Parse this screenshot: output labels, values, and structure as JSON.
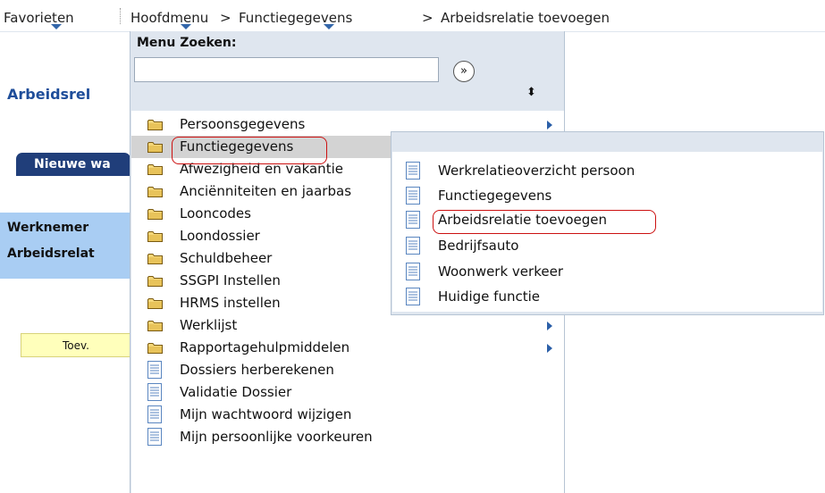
{
  "nav": {
    "favorieten": "Favorieten",
    "hoofdmenu": "Hoofdmenu",
    "sep1": ">",
    "functiegegevens": "Functiegegevens",
    "sep2": ">",
    "arbeidsrelatie": "Arbeidsrelatie toevoegen"
  },
  "background_page": {
    "title": "Arbeidsrel",
    "new_button": "Nieuwe wa",
    "info_line1": "Werknemer",
    "info_line2": "Arbeidsrelat",
    "toev_button": "Toev."
  },
  "menu_search": {
    "label": "Menu Zoeken:",
    "value": "",
    "go_symbol": "»",
    "sort_symbol": "⬍"
  },
  "menu_items": [
    {
      "label": "Persoonsgegevens",
      "icon": "folder-icon",
      "has_submenu": true
    },
    {
      "label": "Functiegegevens",
      "icon": "folder-icon",
      "has_submenu": false,
      "selected": true
    },
    {
      "label": "Afwezigheid en vakantie",
      "icon": "folder-icon",
      "has_submenu": false
    },
    {
      "label": "Anciënniteiten en jaarbas",
      "icon": "folder-icon",
      "has_submenu": false
    },
    {
      "label": "Looncodes",
      "icon": "folder-icon",
      "has_submenu": false
    },
    {
      "label": "Loondossier",
      "icon": "folder-icon",
      "has_submenu": false
    },
    {
      "label": "Schuldbeheer",
      "icon": "folder-icon",
      "has_submenu": false
    },
    {
      "label": "SSGPI Instellen",
      "icon": "folder-icon",
      "has_submenu": false
    },
    {
      "label": "HRMS instellen",
      "icon": "folder-icon",
      "has_submenu": true
    },
    {
      "label": "Werklijst",
      "icon": "folder-icon",
      "has_submenu": true
    },
    {
      "label": "Rapportagehulpmiddelen",
      "icon": "folder-icon",
      "has_submenu": true
    },
    {
      "label": "Dossiers herberekenen",
      "icon": "document-icon",
      "has_submenu": false
    },
    {
      "label": "Validatie Dossier",
      "icon": "document-icon",
      "has_submenu": false
    },
    {
      "label": "Mijn wachtwoord wijzigen",
      "icon": "document-icon",
      "has_submenu": false
    },
    {
      "label": "Mijn persoonlijke voorkeuren",
      "icon": "document-icon",
      "has_submenu": false
    }
  ],
  "submenu_items": [
    {
      "label": "Werkrelatieoverzicht persoon",
      "icon": "document-icon"
    },
    {
      "label": "Functiegegevens",
      "icon": "document-icon"
    },
    {
      "label": "Arbeidsrelatie toevoegen",
      "icon": "document-icon",
      "highlighted": true
    },
    {
      "label": "Bedrijfsauto",
      "icon": "document-icon"
    },
    {
      "label": "Woonwerk verkeer",
      "icon": "document-icon"
    },
    {
      "label": "Huidige functie",
      "icon": "document-icon"
    }
  ],
  "colors": {
    "title_blue": "#1f4e9a",
    "button_navy": "#203e7a",
    "info_blue": "#a9cdf3",
    "toev_yellow": "#ffffbb",
    "panel_bg": "#dfe6ef",
    "highlight_red": "#cc1111",
    "selected_gray": "#d3d3d3",
    "submenu_arrow": "#2b5fa8"
  }
}
